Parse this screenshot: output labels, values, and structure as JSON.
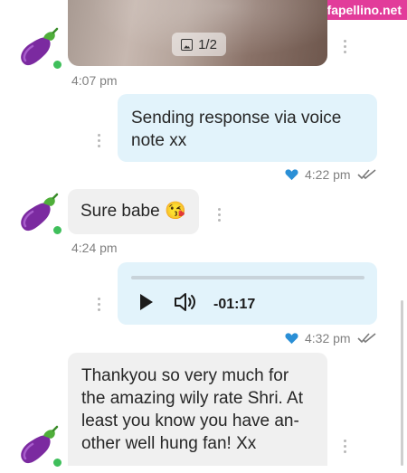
{
  "watermark": "fapellino.net",
  "messages": {
    "photo": {
      "counter": "1/2",
      "time": "4:07 pm"
    },
    "out_text": {
      "text": "Sending response via voice note xx",
      "time": "4:22 pm"
    },
    "in_text": {
      "text": "Sure babe 😘",
      "time": "4:24 pm"
    },
    "audio": {
      "duration": "-01:17",
      "time": "4:32 pm"
    },
    "in_long": {
      "text": "Thankyou so very much for the amazing wily rate Shri. At least you know you have an-other well hung fan! Xx"
    }
  },
  "icons": {
    "avatar": "eggplant-icon",
    "heart": "heart-icon",
    "read": "double-check-icon",
    "menu": "kebab-menu-icon",
    "play": "play-icon",
    "volume": "volume-icon",
    "image": "image-icon"
  },
  "colors": {
    "incoming_bubble": "#f0f0f0",
    "outgoing_bubble": "#e2f3fb",
    "heart": "#2a8fd6",
    "online": "#3fbf5b",
    "watermark_bg": "#e23c9a"
  }
}
